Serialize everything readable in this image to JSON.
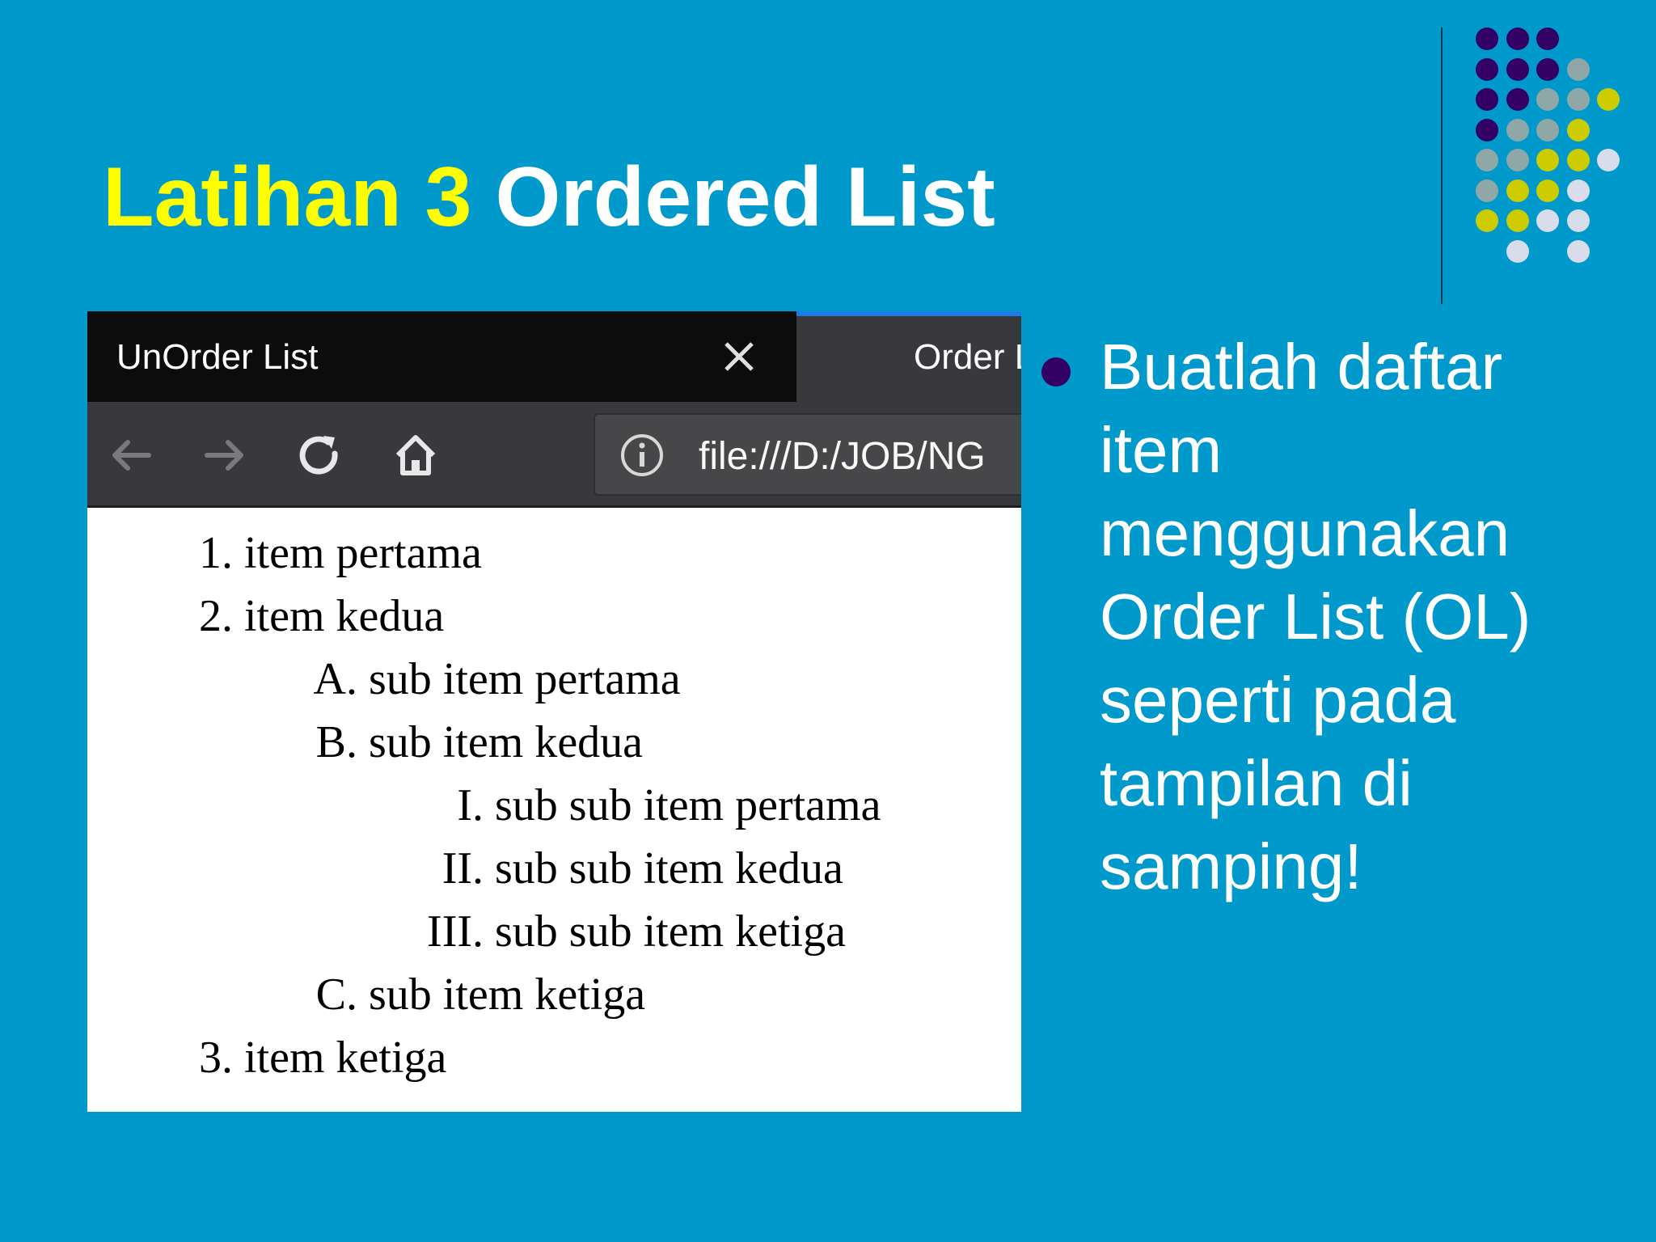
{
  "slide": {
    "title_highlight": "Latihan 3",
    "title_rest": "Ordered List",
    "description": "Buatlah daftar item menggunakan Order List (OL) seperti pada tampilan di samping!"
  },
  "browser": {
    "tabs": [
      {
        "label": "UnOrder List",
        "active": true
      },
      {
        "label": "Order List",
        "active": false
      }
    ],
    "url": "file:///D:/JOB/NG",
    "icons": [
      "back-arrow-icon",
      "forward-arrow-icon",
      "reload-icon",
      "home-icon",
      "info-icon",
      "close-icon"
    ]
  },
  "list": [
    {
      "marker": "1.",
      "text": "item pertama"
    },
    {
      "marker": "2.",
      "text": "item kedua"
    },
    {
      "marker": "A.",
      "text": "sub item pertama"
    },
    {
      "marker": "B.",
      "text": "sub item kedua"
    },
    {
      "marker": "I.",
      "text": "sub sub item pertama"
    },
    {
      "marker": "II.",
      "text": "sub sub item kedua"
    },
    {
      "marker": "III.",
      "text": "sub sub item ketiga"
    },
    {
      "marker": "C.",
      "text": "sub item ketiga"
    },
    {
      "marker": "3.",
      "text": "item ketiga"
    }
  ],
  "colors": {
    "background": "#0099CC",
    "title_highlight": "#FFFF00",
    "title_rest": "#FFFFFF",
    "bullet": "#330066",
    "dot_palette": [
      "#330066",
      "#8FA7A6",
      "#CCCC00",
      "#D9DCEB"
    ]
  }
}
